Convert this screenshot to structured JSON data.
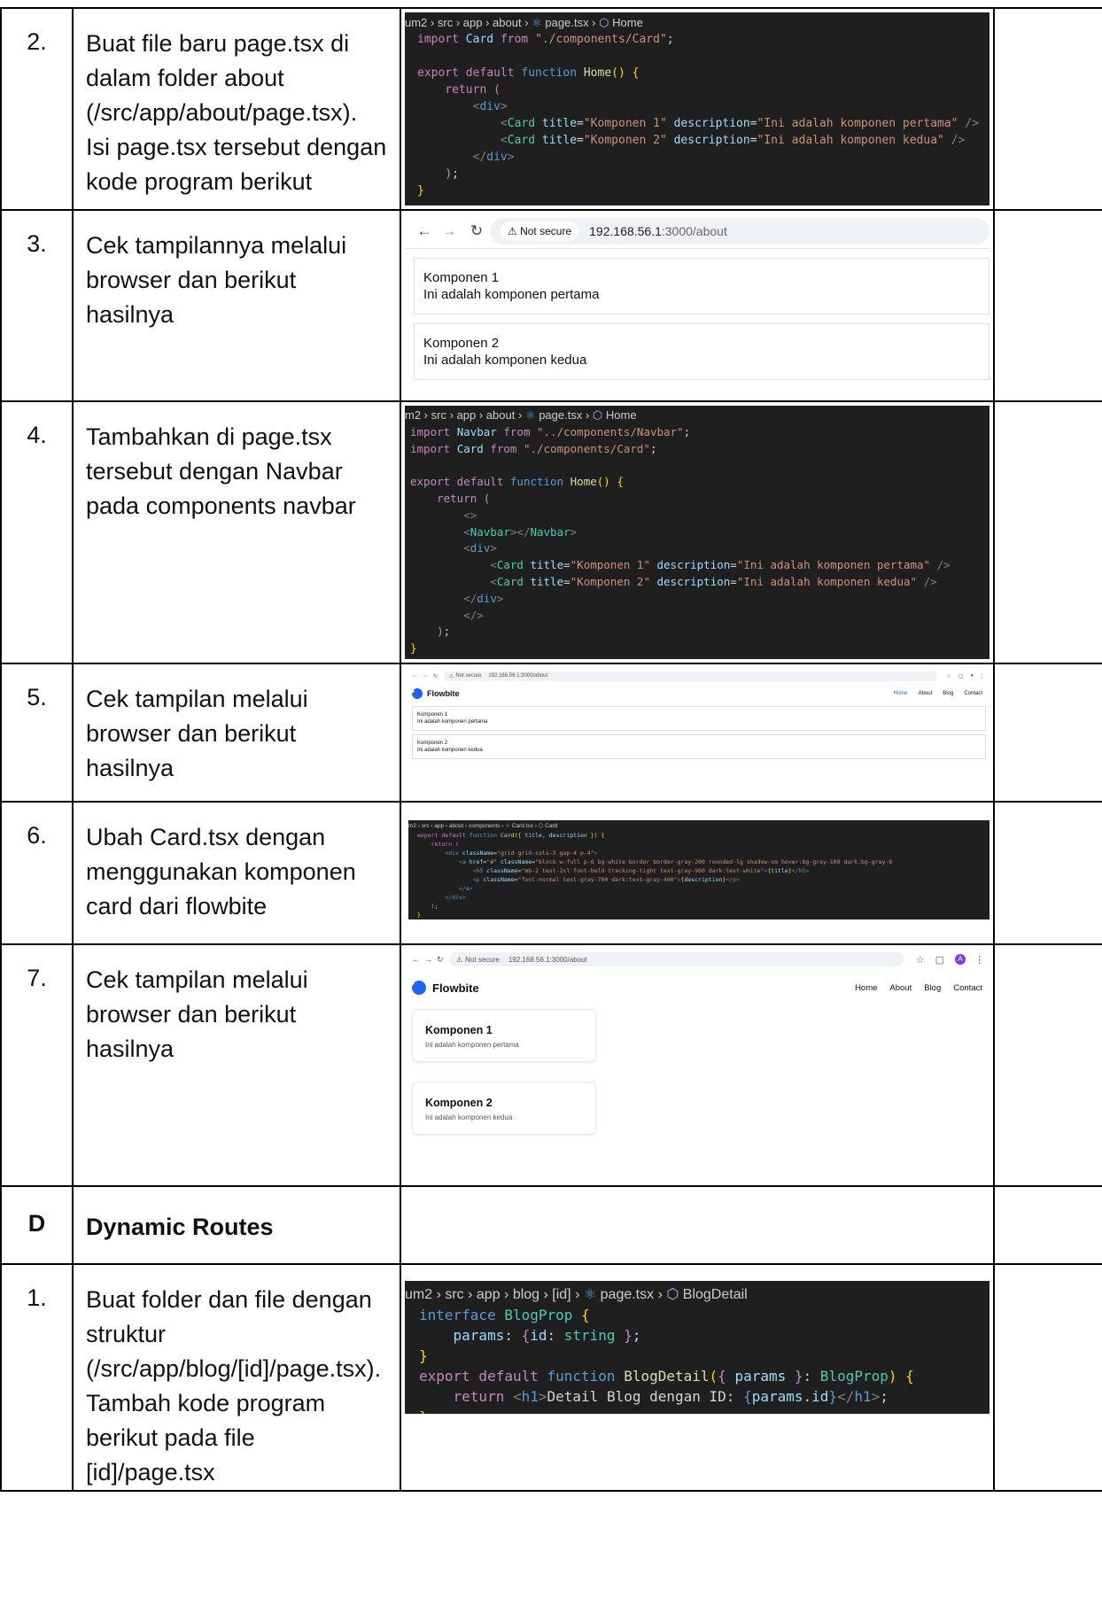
{
  "rows": [
    {
      "num": "2.",
      "step": "Buat file baru page.tsx di dalam folder about (/src/app/about/page.tsx). Isi page.tsx tersebut dengan kode program berikut",
      "code": {
        "crumb": [
          "um2",
          "src",
          "app",
          "about",
          "page.tsx",
          "Home"
        ],
        "lines": [
          "import Card from \"./components/Card\";",
          "",
          "export default function Home() {",
          "    return (",
          "        <div>",
          "            <Card title=\"Komponen 1\" description=\"Ini adalah komponen pertama\" />",
          "            <Card title=\"Komponen 2\" description=\"Ini adalah komponen kedua\" />",
          "        </div>",
          "    );",
          "}"
        ]
      }
    },
    {
      "num": "3.",
      "step": "Cek tampilannya melalui browser dan berikut hasilnya",
      "browser": {
        "not_secure": "Not secure",
        "url_host": "192.168.56.1",
        "url_rest": ":3000/about",
        "cards": [
          {
            "title": "Komponen 1",
            "desc": "Ini adalah komponen pertama"
          },
          {
            "title": "Komponen 2",
            "desc": "Ini adalah komponen kedua"
          }
        ]
      }
    },
    {
      "num": "4.",
      "step": "Tambahkan di page.tsx tersebut dengan Navbar pada components navbar",
      "code": {
        "crumb": [
          "m2",
          "src",
          "app",
          "about",
          "page.tsx",
          "Home"
        ],
        "lines": [
          "import Navbar from \"../components/Navbar\";",
          "import Card from \"./components/Card\";",
          "",
          "export default function Home() {",
          "    return (",
          "        <>",
          "        <Navbar></Navbar>",
          "        <div>",
          "            <Card title=\"Komponen 1\" description=\"Ini adalah komponen pertama\" />",
          "            <Card title=\"Komponen 2\" description=\"Ini adalah komponen kedua\" />",
          "        </div>",
          "        </>",
          "    );",
          "}"
        ]
      }
    },
    {
      "num": "5.",
      "step": "Cek tampilan melalui browser dan berikut hasilnya",
      "browser": {
        "not_secure": "Not secure",
        "url": "192.168.56.1:3000/about",
        "brand": "Flowbite",
        "nav": [
          "Home",
          "About",
          "Blog",
          "Contact"
        ],
        "cards": [
          {
            "title": "Komponen 1",
            "desc": "Ini adalah komponen pertama"
          },
          {
            "title": "Komponen 2",
            "desc": "Ini adalah komponen kedua"
          }
        ]
      }
    },
    {
      "num": "6.",
      "step": "Ubah Card.tsx dengan menggunakan komponen card dari flowbite",
      "code": {
        "crumb": [
          "m2",
          "src",
          "app",
          "about",
          "components",
          "Card.tsx",
          "Card"
        ],
        "lines": [
          "export default function Card({ title, description }) {",
          "    return (",
          "        <div className=\"grid grid-cols-3 gap-4 p-4\">",
          "            <a href=\"#\" className=\"block w-full p-6 bg-white border border-gray-200 rounded-lg shadow-sm hover:bg-gray-100 dark:bg-gray-8",
          "                <h5 className=\"mb-2 text-2xl font-bold tracking-tight text-gray-900 dark:text-white\">{title}</h5>",
          "                <p className=\"font-normal text-gray-700 dark:text-gray-400\">{description}</p>",
          "            </a>",
          "        </div>",
          "    );",
          "}"
        ]
      }
    },
    {
      "num": "7.",
      "step": "Cek tampilan melalui browser dan berikut hasilnya",
      "browser": {
        "not_secure": "Not secure",
        "url": "192.168.56.1:3000/about",
        "brand": "Flowbite",
        "nav": [
          "Home",
          "About",
          "Blog",
          "Contact"
        ],
        "avatar": "A",
        "cards": [
          {
            "title": "Komponen 1",
            "desc": "Ini adalah komponen pertama"
          },
          {
            "title": "Komponen 2",
            "desc": "Ini adalah komponen kedua"
          }
        ]
      }
    },
    {
      "num": "D",
      "step": "Dynamic Routes"
    },
    {
      "num": "1.",
      "step": "Buat folder dan file dengan struktur (/src/app/blog/[id]/page.tsx). Tambah kode program berikut pada file [id]/page.tsx",
      "code": {
        "crumb": [
          "um2",
          "src",
          "app",
          "blog",
          "[id]",
          "page.tsx",
          "BlogDetail"
        ],
        "lines": [
          "interface BlogProp {",
          "    params: {id: string };",
          "}",
          "export default function BlogDetail({ params }: BlogProp) {",
          "    return <h1>Detail Blog dengan ID: {params.id}</h1>;",
          "}"
        ]
      }
    }
  ]
}
